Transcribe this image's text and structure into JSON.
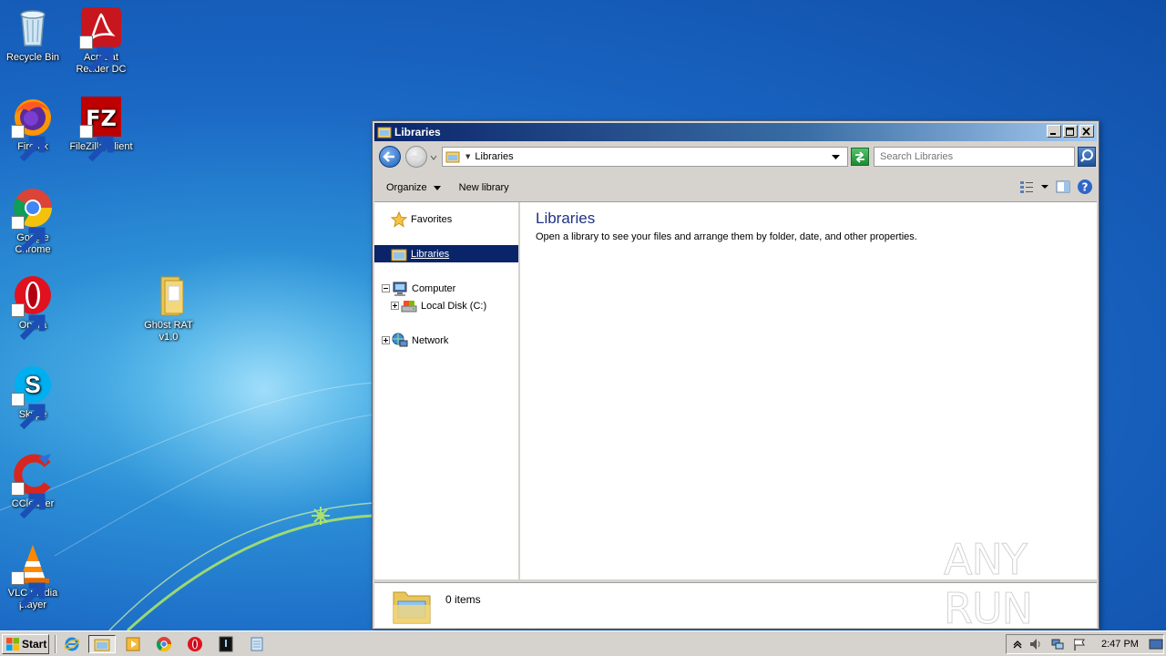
{
  "desktop": {
    "icons": [
      {
        "label": "Recycle Bin"
      },
      {
        "label": "Acrobat Reader DC"
      },
      {
        "label": "Firefox"
      },
      {
        "label": "FileZilla Client"
      },
      {
        "label": "Google Chrome"
      },
      {
        "label": "Opera"
      },
      {
        "label": "Gh0st RAT v1.0"
      },
      {
        "label": "Skype"
      },
      {
        "label": "CCleaner"
      },
      {
        "label": "VLC media player"
      }
    ]
  },
  "window": {
    "title": "Libraries",
    "address": "Libraries",
    "search_placeholder": "Search Libraries",
    "toolbar": {
      "organize_label": "Organize",
      "new_library_label": "New library"
    },
    "nav": {
      "favorites": "Favorites",
      "libraries": "Libraries",
      "computer": "Computer",
      "local_disk": "Local Disk (C:)",
      "network": "Network"
    },
    "main": {
      "heading": "Libraries",
      "description": "Open a library to see your files and arrange them by folder, date, and other properties."
    },
    "details": {
      "count": "0 items"
    }
  },
  "watermark": "ANY RUN",
  "taskbar": {
    "start_label": "Start",
    "clock": "2:47 PM"
  },
  "colors": {
    "desktop_blue": "#1a67c4",
    "titlebar_start": "#0a246a",
    "titlebar_end": "#a6caf0",
    "selection": "#0a246a",
    "heading_text": "#1e3287",
    "chrome_gray": "#d6d3ce"
  }
}
